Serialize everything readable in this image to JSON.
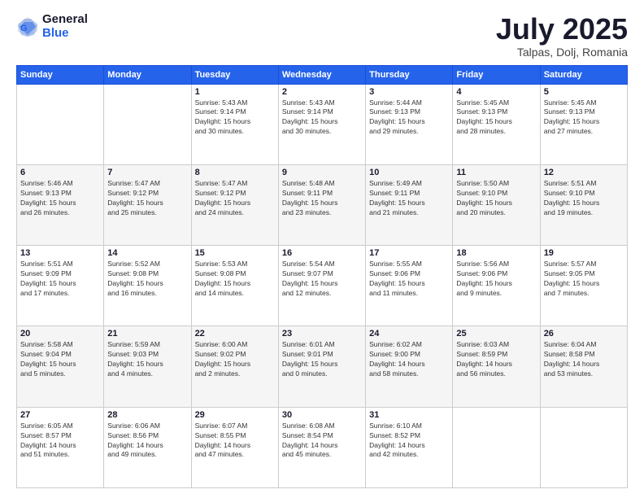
{
  "logo": {
    "general": "General",
    "blue": "Blue"
  },
  "header": {
    "month": "July 2025",
    "location": "Talpas, Dolj, Romania"
  },
  "weekdays": [
    "Sunday",
    "Monday",
    "Tuesday",
    "Wednesday",
    "Thursday",
    "Friday",
    "Saturday"
  ],
  "weeks": [
    [
      {
        "day": "",
        "info": ""
      },
      {
        "day": "",
        "info": ""
      },
      {
        "day": "1",
        "info": "Sunrise: 5:43 AM\nSunset: 9:14 PM\nDaylight: 15 hours\nand 30 minutes."
      },
      {
        "day": "2",
        "info": "Sunrise: 5:43 AM\nSunset: 9:14 PM\nDaylight: 15 hours\nand 30 minutes."
      },
      {
        "day": "3",
        "info": "Sunrise: 5:44 AM\nSunset: 9:13 PM\nDaylight: 15 hours\nand 29 minutes."
      },
      {
        "day": "4",
        "info": "Sunrise: 5:45 AM\nSunset: 9:13 PM\nDaylight: 15 hours\nand 28 minutes."
      },
      {
        "day": "5",
        "info": "Sunrise: 5:45 AM\nSunset: 9:13 PM\nDaylight: 15 hours\nand 27 minutes."
      }
    ],
    [
      {
        "day": "6",
        "info": "Sunrise: 5:46 AM\nSunset: 9:13 PM\nDaylight: 15 hours\nand 26 minutes."
      },
      {
        "day": "7",
        "info": "Sunrise: 5:47 AM\nSunset: 9:12 PM\nDaylight: 15 hours\nand 25 minutes."
      },
      {
        "day": "8",
        "info": "Sunrise: 5:47 AM\nSunset: 9:12 PM\nDaylight: 15 hours\nand 24 minutes."
      },
      {
        "day": "9",
        "info": "Sunrise: 5:48 AM\nSunset: 9:11 PM\nDaylight: 15 hours\nand 23 minutes."
      },
      {
        "day": "10",
        "info": "Sunrise: 5:49 AM\nSunset: 9:11 PM\nDaylight: 15 hours\nand 21 minutes."
      },
      {
        "day": "11",
        "info": "Sunrise: 5:50 AM\nSunset: 9:10 PM\nDaylight: 15 hours\nand 20 minutes."
      },
      {
        "day": "12",
        "info": "Sunrise: 5:51 AM\nSunset: 9:10 PM\nDaylight: 15 hours\nand 19 minutes."
      }
    ],
    [
      {
        "day": "13",
        "info": "Sunrise: 5:51 AM\nSunset: 9:09 PM\nDaylight: 15 hours\nand 17 minutes."
      },
      {
        "day": "14",
        "info": "Sunrise: 5:52 AM\nSunset: 9:08 PM\nDaylight: 15 hours\nand 16 minutes."
      },
      {
        "day": "15",
        "info": "Sunrise: 5:53 AM\nSunset: 9:08 PM\nDaylight: 15 hours\nand 14 minutes."
      },
      {
        "day": "16",
        "info": "Sunrise: 5:54 AM\nSunset: 9:07 PM\nDaylight: 15 hours\nand 12 minutes."
      },
      {
        "day": "17",
        "info": "Sunrise: 5:55 AM\nSunset: 9:06 PM\nDaylight: 15 hours\nand 11 minutes."
      },
      {
        "day": "18",
        "info": "Sunrise: 5:56 AM\nSunset: 9:06 PM\nDaylight: 15 hours\nand 9 minutes."
      },
      {
        "day": "19",
        "info": "Sunrise: 5:57 AM\nSunset: 9:05 PM\nDaylight: 15 hours\nand 7 minutes."
      }
    ],
    [
      {
        "day": "20",
        "info": "Sunrise: 5:58 AM\nSunset: 9:04 PM\nDaylight: 15 hours\nand 5 minutes."
      },
      {
        "day": "21",
        "info": "Sunrise: 5:59 AM\nSunset: 9:03 PM\nDaylight: 15 hours\nand 4 minutes."
      },
      {
        "day": "22",
        "info": "Sunrise: 6:00 AM\nSunset: 9:02 PM\nDaylight: 15 hours\nand 2 minutes."
      },
      {
        "day": "23",
        "info": "Sunrise: 6:01 AM\nSunset: 9:01 PM\nDaylight: 15 hours\nand 0 minutes."
      },
      {
        "day": "24",
        "info": "Sunrise: 6:02 AM\nSunset: 9:00 PM\nDaylight: 14 hours\nand 58 minutes."
      },
      {
        "day": "25",
        "info": "Sunrise: 6:03 AM\nSunset: 8:59 PM\nDaylight: 14 hours\nand 56 minutes."
      },
      {
        "day": "26",
        "info": "Sunrise: 6:04 AM\nSunset: 8:58 PM\nDaylight: 14 hours\nand 53 minutes."
      }
    ],
    [
      {
        "day": "27",
        "info": "Sunrise: 6:05 AM\nSunset: 8:57 PM\nDaylight: 14 hours\nand 51 minutes."
      },
      {
        "day": "28",
        "info": "Sunrise: 6:06 AM\nSunset: 8:56 PM\nDaylight: 14 hours\nand 49 minutes."
      },
      {
        "day": "29",
        "info": "Sunrise: 6:07 AM\nSunset: 8:55 PM\nDaylight: 14 hours\nand 47 minutes."
      },
      {
        "day": "30",
        "info": "Sunrise: 6:08 AM\nSunset: 8:54 PM\nDaylight: 14 hours\nand 45 minutes."
      },
      {
        "day": "31",
        "info": "Sunrise: 6:10 AM\nSunset: 8:52 PM\nDaylight: 14 hours\nand 42 minutes."
      },
      {
        "day": "",
        "info": ""
      },
      {
        "day": "",
        "info": ""
      }
    ]
  ]
}
